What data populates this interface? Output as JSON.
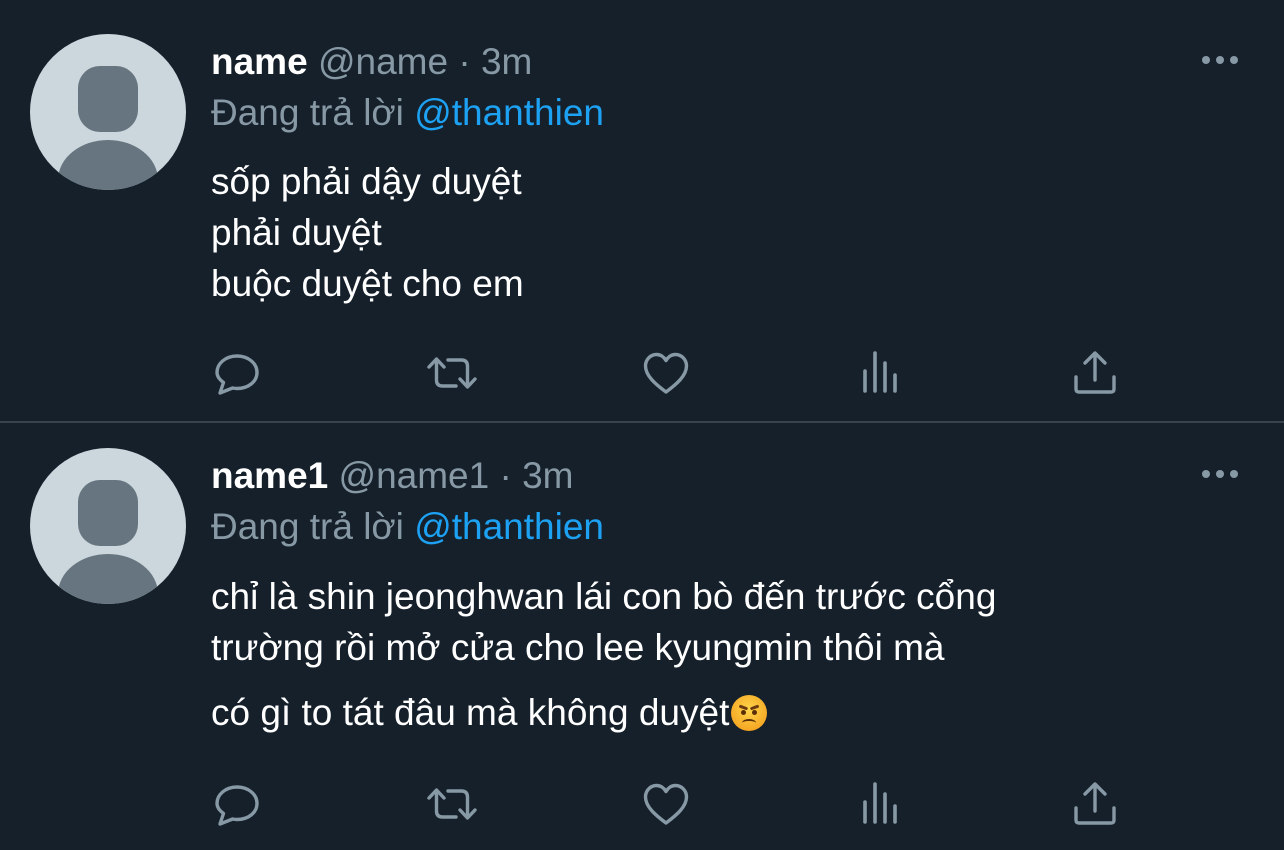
{
  "tweets": [
    {
      "name": "name",
      "handle": "@name",
      "separator": "·",
      "time": "3m",
      "replying_prefix": "Đang trả lời",
      "replying_to": "@thanthien",
      "lines": [
        "sốp phải dậy duyệt",
        "phải duyệt",
        "buộc duyệt cho em"
      ],
      "emoji": ""
    },
    {
      "name": "name1",
      "handle": "@name1",
      "separator": "·",
      "time": "3m",
      "replying_prefix": "Đang trả lời",
      "replying_to": "@thanthien",
      "lines": [
        "chỉ là shin jeonghwan lái con bò đến trước cổng",
        "trường rồi mở cửa cho lee kyungmin thôi mà",
        "có gì to tát đâu mà không duyệt"
      ],
      "emoji": "angry-face"
    }
  ],
  "actions": [
    "reply-icon",
    "retweet-icon",
    "like-icon",
    "analytics-icon",
    "share-icon"
  ],
  "colors": {
    "background": "#15202b",
    "divider": "#38444d",
    "primary_text": "#ffffff",
    "secondary_text": "#8899a6",
    "accent": "#1da1f2",
    "avatar_bg": "#ccd6dd",
    "avatar_fg": "#66757f"
  }
}
